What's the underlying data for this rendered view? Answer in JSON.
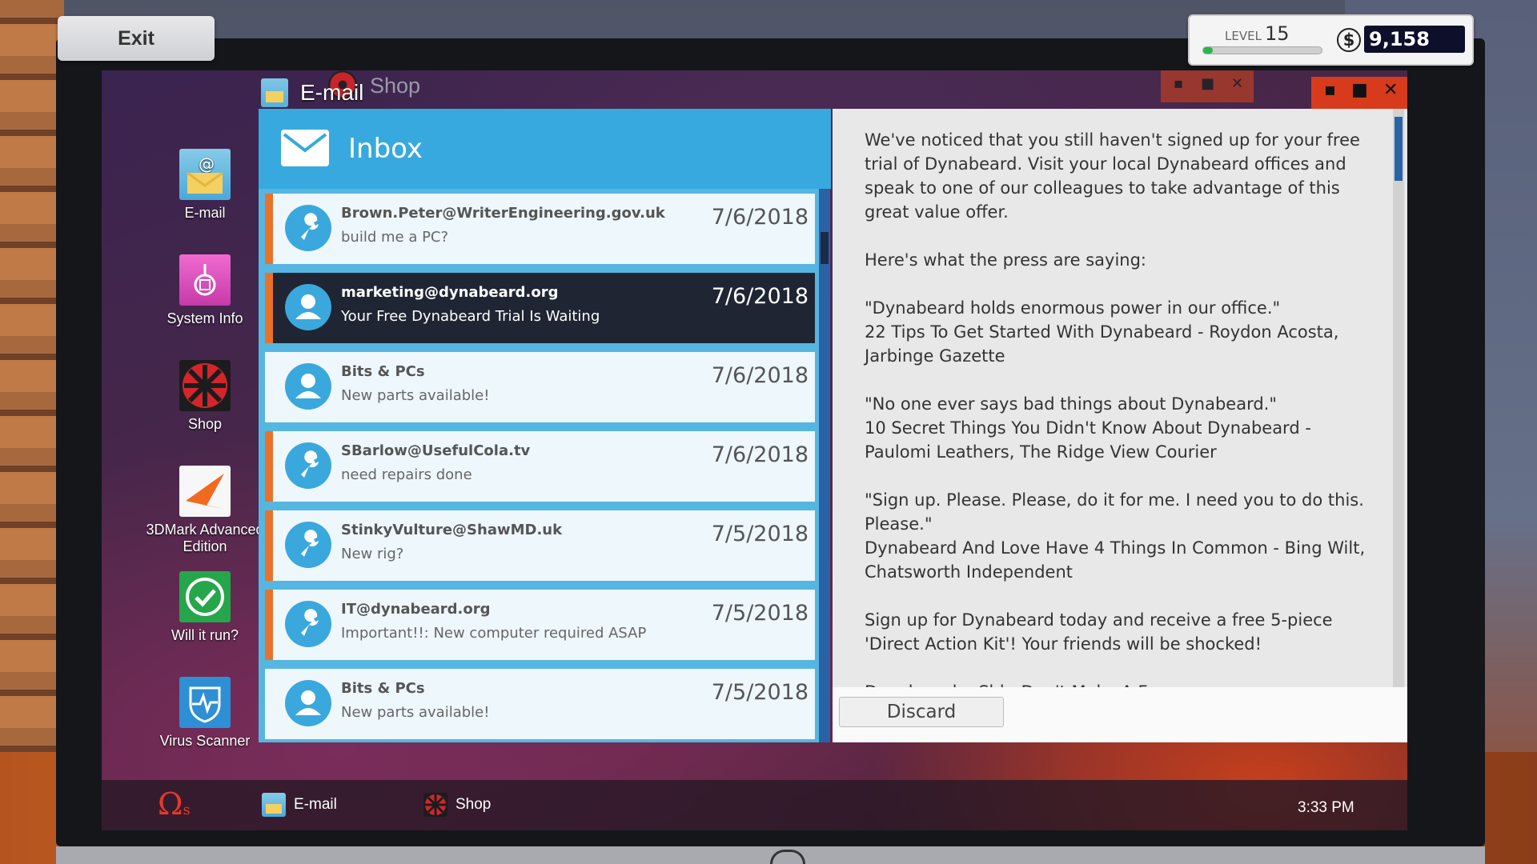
{
  "hud": {
    "exit_label": "Exit",
    "level_label": "LEVEL",
    "level_value": "15",
    "xp_progress": 0.08,
    "currency_symbol": "$",
    "money": "9,158"
  },
  "desktop_icons": [
    {
      "label": "E-mail",
      "icon": "email-icon"
    },
    {
      "label": "System Info",
      "icon": "system-info-icon"
    },
    {
      "label": "Shop",
      "icon": "shop-icon"
    },
    {
      "label": "3DMark Advanced Edition",
      "icon": "3dmark-icon"
    },
    {
      "label": "Will it run?",
      "icon": "checkmark-icon"
    },
    {
      "label": "Virus Scanner",
      "icon": "virus-scanner-icon"
    }
  ],
  "background_window": {
    "title": "Shop",
    "ctrl_min": "▪",
    "ctrl_max": "■",
    "ctrl_close": "✕"
  },
  "email_window": {
    "title": "E-mail",
    "ctrl_min": "▪",
    "ctrl_max": "■",
    "ctrl_close": "✕",
    "inbox_title": "Inbox",
    "messages": [
      {
        "from": "Brown.Peter@WriterEngineering.gov.uk",
        "subject": "build me a PC?",
        "date": "7/6/2018",
        "icon": "wrench-icon"
      },
      {
        "from": "marketing@dynabeard.org",
        "subject": "Your Free Dynabeard Trial Is Waiting",
        "date": "7/6/2018",
        "icon": "person-icon"
      },
      {
        "from": "Bits & PCs",
        "subject": "New parts available!",
        "date": "7/6/2018",
        "icon": "person-icon"
      },
      {
        "from": "SBarlow@UsefulCola.tv",
        "subject": "need repairs done",
        "date": "7/6/2018",
        "icon": "wrench-icon"
      },
      {
        "from": "StinkyVulture@ShawMD.uk",
        "subject": "New rig?",
        "date": "7/5/2018",
        "icon": "wrench-icon"
      },
      {
        "from": "IT@dynabeard.org",
        "subject": "Important!!: New computer required ASAP",
        "date": "7/5/2018",
        "icon": "wrench-icon"
      },
      {
        "from": "Bits & PCs",
        "subject": "New parts available!",
        "date": "7/5/2018",
        "icon": "person-icon"
      }
    ],
    "body_paragraphs": [
      "We've noticed that you still haven't signed up for your free trial of Dynabeard. Visit your local Dynabeard offices and speak to one of our colleagues to take advantage of this great value offer.",
      "Here's what the press are saying:",
      "\"Dynabeard holds enormous power in our office.\"\n22 Tips To Get Started With Dynabeard - Roydon Acosta, Jarbinge Gazette",
      "\"No one ever says bad things about Dynabeard.\"\n10 Secret Things You Didn't Know About Dynabeard - Paulomi Leathers, The Ridge View Courier",
      "\"Sign up. Please. Please, do it for me. I need you to do this. Please.\"\nDynabeard And Love Have 4 Things In Common - Bing Wilt, Chatsworth Independent",
      "Sign up for Dynabeard today and receive a free 5-piece 'Direct Action Kit'! Your friends will be shocked!",
      "Dynabeard... Shh. Don't Make A Fuzz."
    ],
    "discard_label": "Discard"
  },
  "taskbar": {
    "os_logo": "Ω",
    "os_logo_suffix": "s",
    "items": [
      {
        "label": "E-mail"
      },
      {
        "label": "Shop"
      }
    ],
    "clock": "3:33 PM"
  },
  "colors": {
    "accent_blue": "#37a9df",
    "unread_accent": "#e8722a",
    "selected_row": "#1f2533",
    "close_red": "#d83a1c"
  }
}
